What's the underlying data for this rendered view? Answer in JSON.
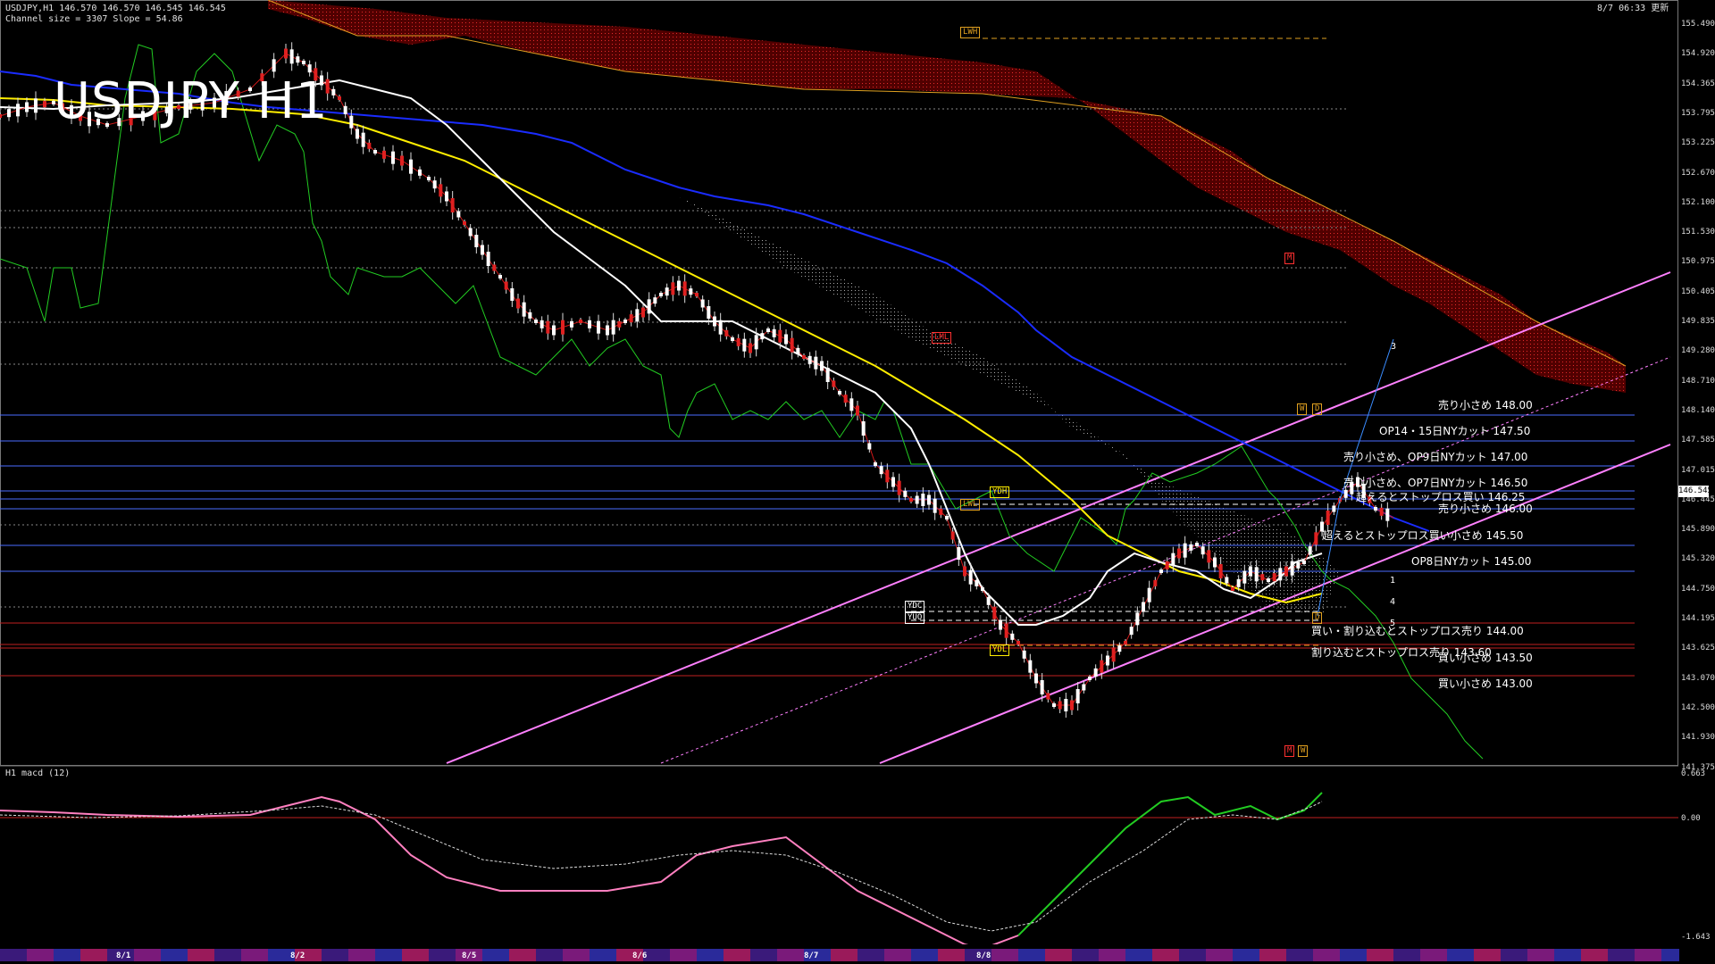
{
  "header": {
    "line1": "USDJPY,H1  146.570 146.570 146.545 146.545",
    "line2": "Channel size = 3307 Slope = 54.86",
    "timestamp": "8/7 06:33 更新"
  },
  "overlay_title": "USDJPY H1",
  "y_axis": [
    "155.490",
    "154.920",
    "154.365",
    "153.795",
    "153.225",
    "152.670",
    "152.100",
    "151.530",
    "150.975",
    "150.405",
    "149.835",
    "149.280",
    "148.710",
    "148.140",
    "147.585",
    "147.015",
    "146.445",
    "145.890",
    "145.320",
    "144.750",
    "144.195",
    "143.625",
    "143.070",
    "142.500",
    "141.930",
    "141.375"
  ],
  "current_price": "146.545",
  "levels": [
    {
      "text": "売り小さめ 148.00"
    },
    {
      "text": "OP14・15日NYカット 147.50"
    },
    {
      "text": "売り小さめ、OP9日NYカット 147.00"
    },
    {
      "text": "売り小さめ、OP7日NYカット 146.50"
    },
    {
      "text": "超えるとストップロス買い 146.25"
    },
    {
      "text": "売り小さめ 146.00"
    },
    {
      "text": "超えるとストップロス買い小さめ 145.50"
    },
    {
      "text": "OP8日NYカット 145.00"
    },
    {
      "text": "買い・割り込むとストップロス売り 144.00"
    },
    {
      "text": "割り込むとストップロス売り 143.60"
    },
    {
      "text": "買い小さめ 143.50"
    },
    {
      "text": "買い小さめ 143.00"
    }
  ],
  "tags": {
    "lwh": "LWH",
    "lwl": "LWL",
    "ydh": "YDH",
    "ydc": "YDC",
    "yuo": "YUO",
    "ydl": "YDL",
    "lml": "LML",
    "w1": "W",
    "d1": "D",
    "d2": "D",
    "m1": "M",
    "m2": "M",
    "w2": "W",
    "n3": "3",
    "n1": "1",
    "n4": "4",
    "n5": "5"
  },
  "macd_panel": {
    "label": "H1  macd (12)",
    "y_axis": [
      "0.663",
      "0.00",
      "-1.643"
    ]
  },
  "date_axis": [
    "8/1",
    "8/2",
    "8/5",
    "8/6",
    "8/7",
    "8/8"
  ],
  "colors": {
    "ichimoku_cloud": "#b00000",
    "ma_yellow": "#ffee00",
    "ma_white": "#ffffff",
    "ma_blue": "#1a2cff",
    "channel": "#ff80ff",
    "rsi_green": "#22cc22",
    "macd_pink": "#ff80c0"
  }
}
